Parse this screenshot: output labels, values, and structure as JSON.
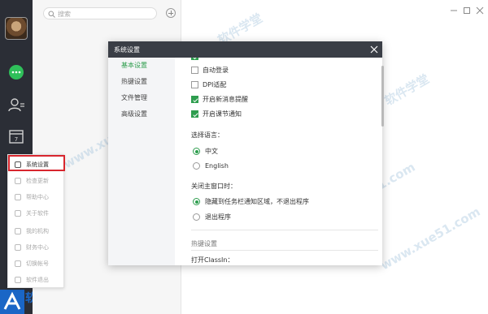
{
  "search": {
    "placeholder": "搜索"
  },
  "dialog": {
    "title": "系统设置",
    "nav": [
      {
        "label": "基本设置",
        "active": true
      },
      {
        "label": "热键设置",
        "active": false
      },
      {
        "label": "文件管理",
        "active": false
      },
      {
        "label": "高级设置",
        "active": false
      }
    ],
    "checkboxes": [
      {
        "label": "自动登录",
        "checked": false
      },
      {
        "label": "DPI适配",
        "checked": false
      },
      {
        "label": "开启新消息提醒",
        "checked": true
      },
      {
        "label": "开启课节通知",
        "checked": true
      }
    ],
    "language": {
      "label": "选择语言：",
      "options": [
        {
          "label": "中文",
          "selected": true
        },
        {
          "label": "English",
          "selected": false
        }
      ]
    },
    "close_behavior": {
      "label": "关闭主窗口时：",
      "options": [
        {
          "label": "隐藏到任务栏通知区域，不退出程序",
          "selected": true
        },
        {
          "label": "退出程序",
          "selected": false
        }
      ]
    },
    "hotkey_section": "热键设置",
    "open_classin": "打开ClassIn："
  },
  "menu": {
    "items": [
      {
        "label": "系统设置",
        "icon": "sliders-icon",
        "active": true
      },
      {
        "label": "检查更新",
        "icon": "refresh-icon",
        "active": false
      },
      {
        "label": "帮助中心",
        "icon": "help-icon",
        "active": false
      },
      {
        "label": "关于软件",
        "icon": "info-icon",
        "active": false
      },
      {
        "label": "我的机构",
        "icon": "org-icon",
        "active": false
      },
      {
        "label": "财务中心",
        "icon": "wallet-icon",
        "active": false
      },
      {
        "label": "切换帐号",
        "icon": "switch-icon",
        "active": false
      },
      {
        "label": "软件退出",
        "icon": "exit-icon",
        "active": false
      }
    ]
  },
  "brand": {
    "text": "软"
  },
  "watermarks": [
    "软件学堂",
    "www.xue51.com",
    "软件学堂",
    "www.xue51.com",
    "www.xue51.com"
  ],
  "colors": {
    "accent": "#2e9d4e",
    "rail": "#2b2e36",
    "dialog_header": "#3a3e46",
    "highlight": "#d8262e"
  }
}
